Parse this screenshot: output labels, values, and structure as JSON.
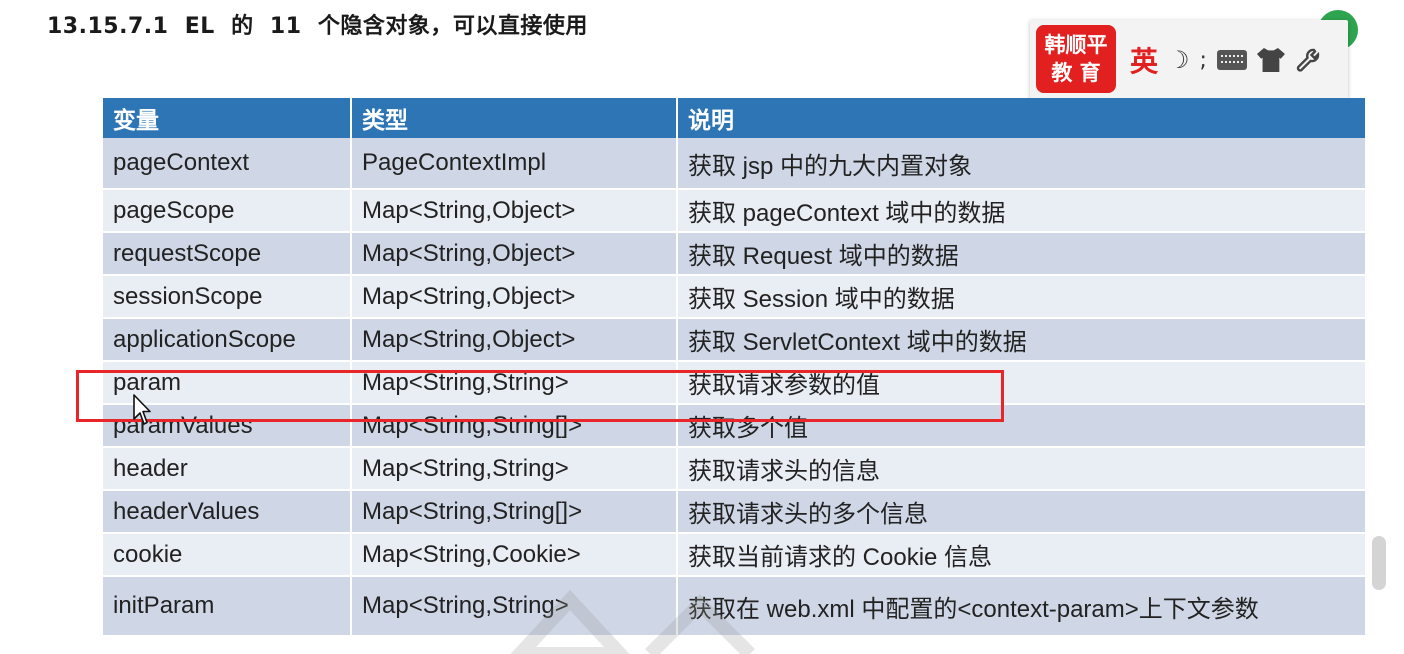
{
  "heading": "13.15.7.1  EL  的  11  个隐含对象，可以直接使用",
  "ime": {
    "logo_line1": "韩顺平",
    "logo_line2": "教 育",
    "lang": "英",
    "moon": "☽",
    "sep": ";",
    "colors": {
      "logo": "#e32020",
      "lang": "#e32020"
    }
  },
  "table": {
    "header": {
      "col1": "变量",
      "col2": "类型",
      "col3": "说明",
      "color": "#2e75b6"
    },
    "rows": [
      {
        "var": "pageContext",
        "type": "PageContextImpl",
        "desc": "获取 jsp 中的九大内置对象"
      },
      {
        "var": "pageScope",
        "type": "Map<String,Object>",
        "desc": "获取 pageContext 域中的数据"
      },
      {
        "var": "requestScope",
        "type": "Map<String,Object>",
        "desc": "获取 Request 域中的数据"
      },
      {
        "var": "sessionScope",
        "type": "Map<String,Object>",
        "desc": "获取 Session 域中的数据"
      },
      {
        "var": "applicationScope",
        "type": "Map<String,Object>",
        "desc": "获取 ServletContext 域中的数据"
      },
      {
        "var": "param",
        "type": "Map<String,String>",
        "desc": "获取请求参数的值"
      },
      {
        "var": "paramValues",
        "type": "Map<String,String[]>",
        "desc": "获取多个值"
      },
      {
        "var": "header",
        "type": "Map<String,String>",
        "desc": "获取请求头的信息"
      },
      {
        "var": "headerValues",
        "type": "Map<String,String[]>",
        "desc": "获取请求头的多个信息"
      },
      {
        "var": "cookie",
        "type": "Map<String,Cookie>",
        "desc": "获取当前请求的 Cookie 信息"
      },
      {
        "var": "initParam",
        "type": "Map<String,String>",
        "desc": "获取在 web.xml 中配置的<context-param>上下文参数"
      }
    ],
    "highlighted_row": "param",
    "highlight_color": "#e8262a"
  }
}
